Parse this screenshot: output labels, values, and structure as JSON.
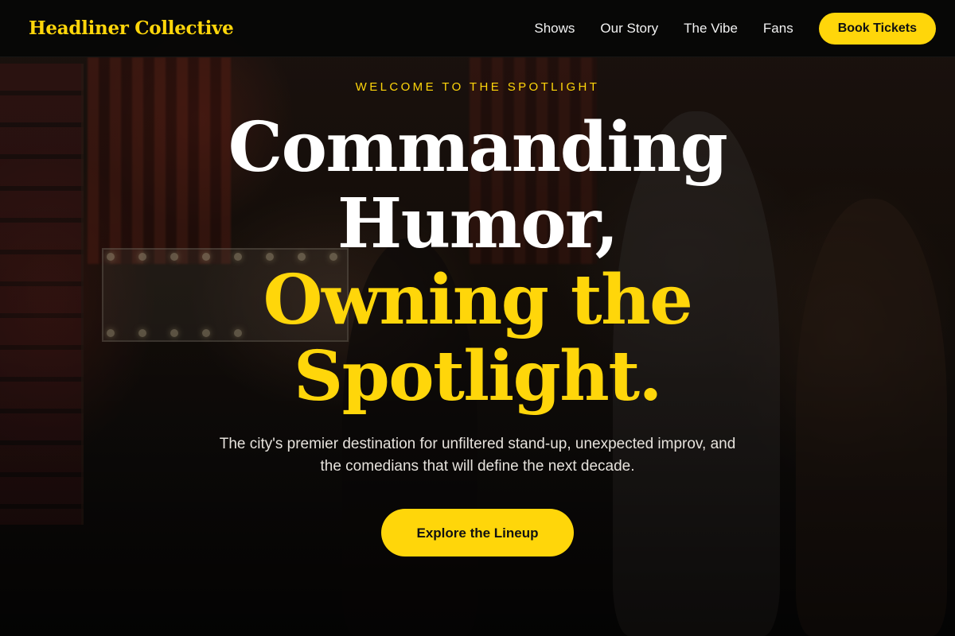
{
  "nav": {
    "brand": "Headliner Collective",
    "links": [
      {
        "label": "Shows"
      },
      {
        "label": "Our Story"
      },
      {
        "label": "The Vibe"
      },
      {
        "label": "Fans"
      }
    ],
    "cta_label": "Book Tickets"
  },
  "hero": {
    "eyebrow": "WELCOME TO THE SPOTLIGHT",
    "headline_lines": [
      {
        "text": "Commanding",
        "style": "white"
      },
      {
        "text": "Humor,",
        "style": "white"
      },
      {
        "text": "Owning the",
        "style": "gold"
      },
      {
        "text": "Spotlight.",
        "style": "gold"
      }
    ],
    "subtitle": "The city's premier destination for unfiltered stand-up, unexpected improv, and the comedians that will define the next decade.",
    "cta_label": "Explore the Lineup",
    "background_image": "comedy-club-entrance-photo"
  },
  "colors": {
    "accent": "#ffd60a",
    "nav_bg": "#060606",
    "text_light": "#ffffff"
  }
}
